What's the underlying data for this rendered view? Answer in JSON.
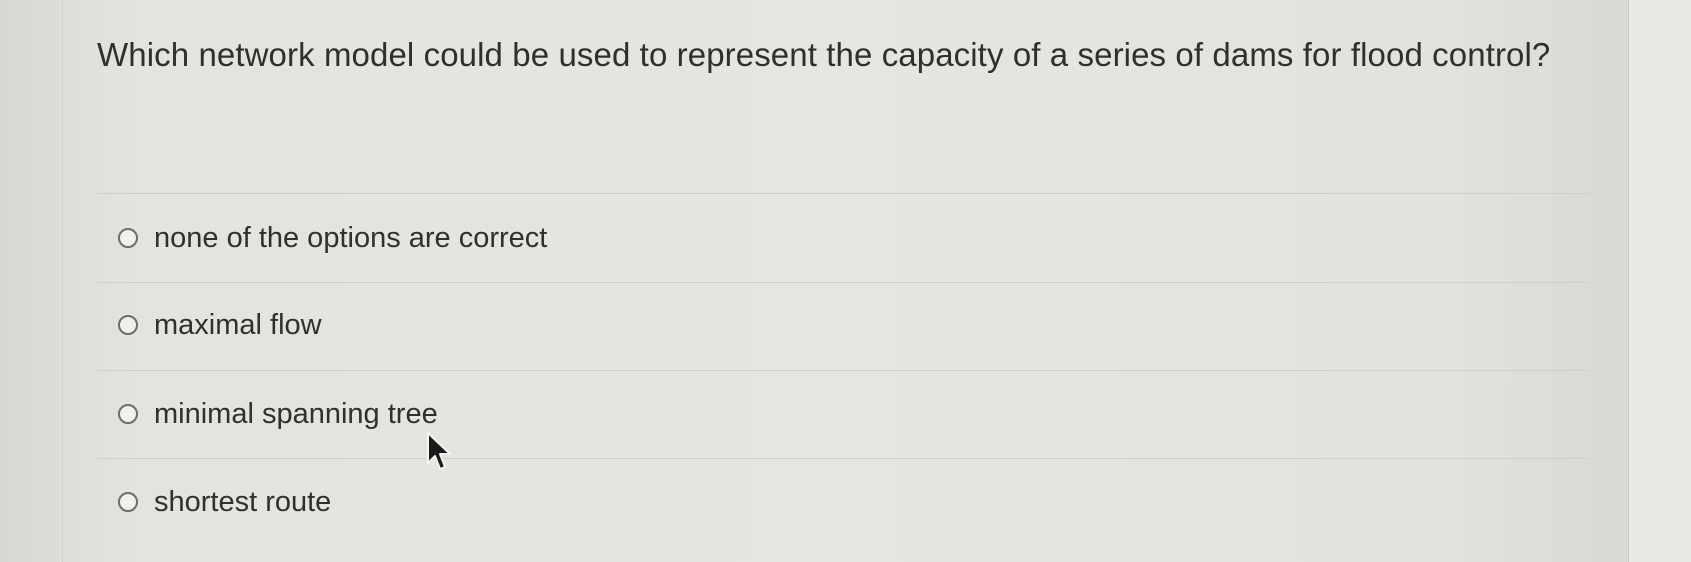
{
  "question": {
    "text": "Which network model could be used to represent the capacity of a series of dams for flood control?"
  },
  "options": [
    {
      "label": "none of the options are correct",
      "selected": false
    },
    {
      "label": "maximal flow",
      "selected": false
    },
    {
      "label": "minimal spanning tree",
      "selected": false
    },
    {
      "label": "shortest route",
      "selected": false
    }
  ],
  "cursor": {
    "icon": "mouse-pointer-icon"
  }
}
